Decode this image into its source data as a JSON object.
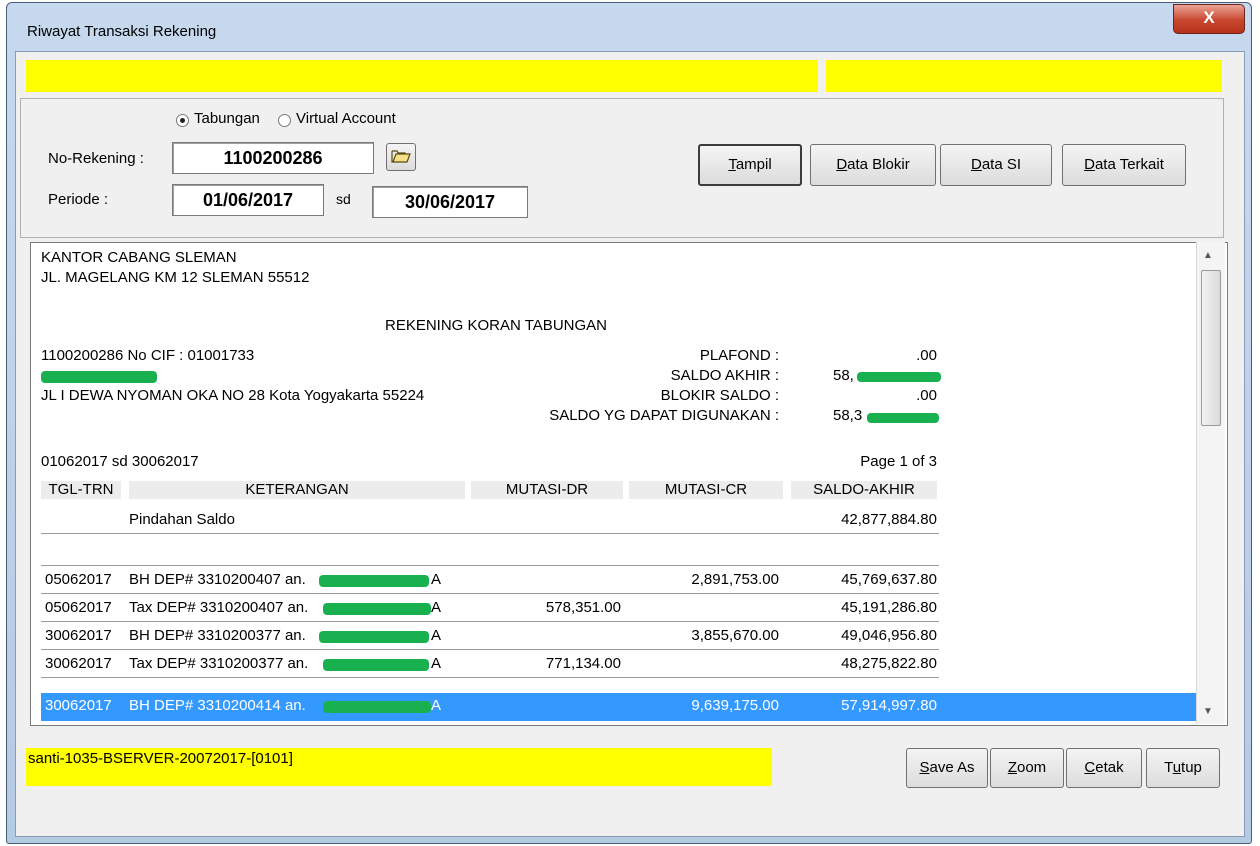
{
  "window": {
    "title": "Riwayat Transaksi Rekening",
    "close_label": "X"
  },
  "account_type": {
    "tabungan": "Tabungan",
    "virtual_account": "Virtual Account",
    "selected": "Tabungan"
  },
  "form": {
    "no_rekening_label": "No-Rekening :",
    "no_rekening_value": "1100200286",
    "periode_label": "Periode :",
    "periode_from": "01/06/2017",
    "sd_label": "sd",
    "periode_to": "30/06/2017"
  },
  "buttons": {
    "tampil": {
      "prefix": "",
      "hotkey": "T",
      "rest": "ampil"
    },
    "data_blokir": {
      "prefix": "",
      "hotkey": "D",
      "rest": "ata Blokir"
    },
    "data_si": {
      "prefix": "",
      "hotkey": "D",
      "rest": "ata SI"
    },
    "data_terkait": {
      "prefix": "",
      "hotkey": "D",
      "rest": "ata Terkait"
    },
    "save_as": {
      "prefix": "",
      "hotkey": "S",
      "rest": "ave As"
    },
    "zoom": {
      "prefix": "",
      "hotkey": "Z",
      "rest": "oom"
    },
    "cetak": {
      "prefix": "",
      "hotkey": "C",
      "rest": "etak"
    },
    "tutup": {
      "prefix": "T",
      "hotkey": "u",
      "rest": "tup"
    }
  },
  "report": {
    "branch_name": "KANTOR CABANG SLEMAN",
    "branch_address": "JL. MAGELANG KM 12 SLEMAN 55512",
    "doc_title": "REKENING KORAN TABUNGAN",
    "account_line": "1100200286 No CIF : 01001733",
    "customer_address": "JL I DEWA NYOMAN OKA NO 28 Kota Yogyakarta 55224",
    "summary": [
      {
        "label": "PLAFOND :",
        "value": ".00"
      },
      {
        "label": "SALDO AKHIR :",
        "value": "58,"
      },
      {
        "label": "BLOKIR SALDO :",
        "value": ".00"
      },
      {
        "label": "SALDO YG DAPAT DIGUNAKAN :",
        "value": "58,3"
      }
    ],
    "period_text": "01062017 sd 30062017",
    "page_text": "Page 1 of 3",
    "columns": [
      "TGL-TRN",
      "KETERANGAN",
      "MUTASI-DR",
      "MUTASI-CR",
      "SALDO-AKHIR"
    ],
    "opening": {
      "keterangan": "Pindahan Saldo",
      "saldo": "42,877,884.80"
    },
    "rows": [
      {
        "tgl": "05062017",
        "keterangan": "BH DEP# 3310200407 an.",
        "suffix": "A",
        "dr": "",
        "cr": "2,891,753.00",
        "saldo": "45,769,637.80"
      },
      {
        "tgl": "05062017",
        "keterangan": "Tax DEP# 3310200407 an.",
        "suffix": "A",
        "dr": "578,351.00",
        "cr": "",
        "saldo": "45,191,286.80"
      },
      {
        "tgl": "30062017",
        "keterangan": "BH DEP# 3310200377 an.",
        "suffix": "A",
        "dr": "",
        "cr": "3,855,670.00",
        "saldo": "49,046,956.80"
      },
      {
        "tgl": "30062017",
        "keterangan": "Tax DEP# 3310200377 an.",
        "suffix": "A",
        "dr": "771,134.00",
        "cr": "",
        "saldo": "48,275,822.80"
      },
      {
        "tgl": "30062017",
        "keterangan": "BH DEP# 3310200414 an.",
        "suffix": "A",
        "dr": "",
        "cr": "9,639,175.00",
        "saldo": "57,914,997.80"
      }
    ]
  },
  "status_text": "santi-1035-BSERVER-20072017-[0101]",
  "colors": {
    "highlight_yellow": "#ffff00",
    "selection_blue": "#3399ff",
    "redaction_green": "#19b050"
  },
  "icons": {
    "open": "folder-open-icon"
  }
}
